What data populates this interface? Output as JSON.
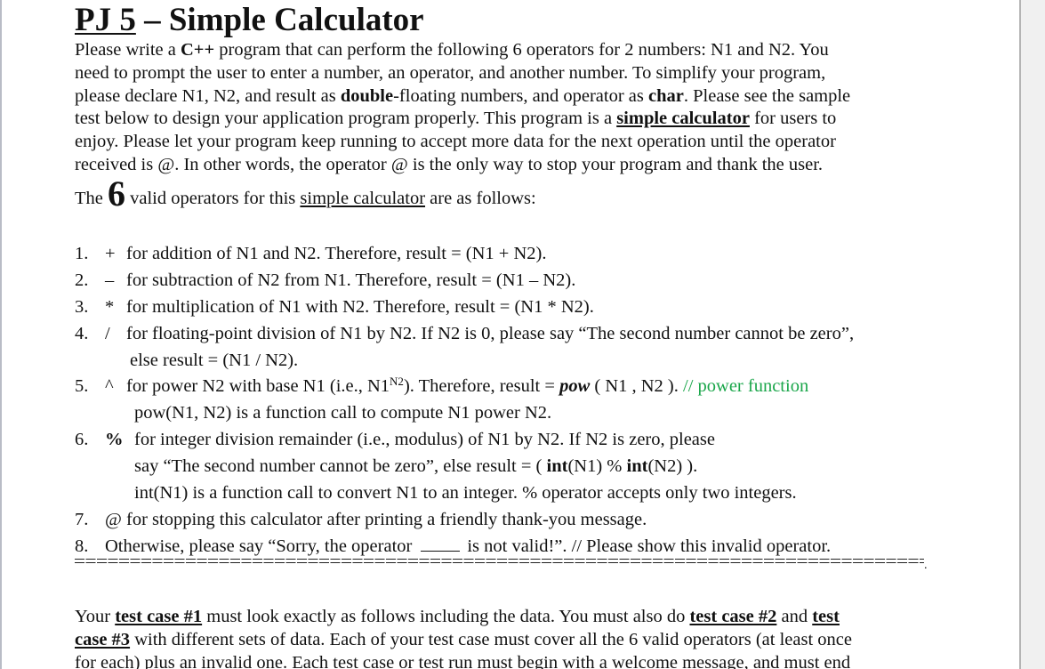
{
  "document": {
    "title_prefix": "PJ 5",
    "title_suffix": " – Simple Calculator",
    "intro_lines": [
      {
        "parts": [
          {
            "t": "Please write a "
          },
          {
            "t": "C++",
            "style": "b"
          },
          {
            "t": " program that can perform the following 6 operators for 2 numbers: N1 and N2.  You"
          }
        ]
      },
      {
        "parts": [
          {
            "t": "need to prompt the user to enter a number, an operator, and another number.  To simplify your program,"
          }
        ]
      },
      {
        "parts": [
          {
            "t": "please declare N1, N2, and result as "
          },
          {
            "t": "double",
            "style": "b"
          },
          {
            "t": "-floating numbers, and operator as "
          },
          {
            "t": "char",
            "style": "b"
          },
          {
            "t": ".  Please see the sample"
          }
        ]
      },
      {
        "parts": [
          {
            "t": "test below to design your application program properly.  This program is a "
          },
          {
            "t": "simple calculator",
            "style": "bu"
          },
          {
            "t": " for users to"
          }
        ]
      },
      {
        "parts": [
          {
            "t": "enjoy.   Please let your program keep running to accept more data for the next operation until the operator"
          }
        ]
      },
      {
        "parts": [
          {
            "t": "received is @.  In other words, the operator @ is the only way to stop your program and thank the user."
          }
        ]
      }
    ],
    "operators_heading": {
      "before": "The ",
      "count": "6",
      "middle": " valid operators for this ",
      "link": "simple calculator",
      "after": " are as follows:"
    },
    "operators": [
      {
        "num": "1.",
        "symbol": "+",
        "text": "for addition of  N1 and N2.  Therefore, result = (N1 + N2)."
      },
      {
        "num": "2.",
        "symbol": "–",
        "text": "for subtraction of  N2 from N1.  Therefore, result = (N1 – N2)."
      },
      {
        "num": "3.",
        "symbol": "*",
        "text": "for multiplication of  N1 with N2.  Therefore, result = (N1 * N2)."
      },
      {
        "num": "4.",
        "symbol": "/",
        "text": "for floating-point division of N1 by N2. If N2 is 0, please say “The second number cannot be zero”,",
        "continuation": [
          "else result = (N1 / N2)."
        ]
      },
      {
        "num": "5.",
        "symbol": "^",
        "text_before_sup": "for power N2 with base N1 (i.e., N1",
        "sup": "N2",
        "text_after_sup": ").  Therefore, result = ",
        "func": "pow",
        "func_args": " ( N1 , N2 ). ",
        "comment": "// power function",
        "continuation": [
          "pow(N1, N2) is a function call to compute N1 power N2."
        ]
      },
      {
        "num": "6.",
        "symbol": "%",
        "text": "for integer division remainder (i.e., modulus) of N1 by N2.  If N2 is zero, please",
        "cont2_before": "say  “The second number cannot be zero”, else result = ( ",
        "cont2_int1": "int",
        "cont2_mid": "(N1) % ",
        "cont2_int2": "int",
        "cont2_after": "(N2) ).",
        "cont3": "int(N1) is a function call to convert N1 to an integer.  % operator accepts only two integers."
      },
      {
        "num": "7.",
        "symbol": "@",
        "text": "for stopping this calculator after printing a friendly thank-you message."
      },
      {
        "num": "8.",
        "text_before_blank": "Otherwise, please say “Sorry, the operator",
        "text_after_blank": "is not valid!”.  // Please show this invalid operator."
      }
    ],
    "separator_end": ".",
    "testcase_lines": [
      {
        "parts": [
          {
            "t": "Your "
          },
          {
            "t": "test case #1",
            "style": "bu"
          },
          {
            "t": " must look exactly as follows including the data. You must also do "
          },
          {
            "t": "test case #2",
            "style": "bu"
          },
          {
            "t": " and "
          },
          {
            "t": "test",
            "style": "bu"
          }
        ]
      },
      {
        "parts": [
          {
            "t": "case #3",
            "style": "bu"
          },
          {
            "t": " with different sets of data.  Each of your test case must cover all the 6 valid operators (at least once"
          }
        ]
      },
      {
        "parts": [
          {
            "t": "for each) plus an invalid one.  Each test case or test run must begin with a welcome message, and must end"
          }
        ]
      }
    ]
  },
  "colors": {
    "comment_green": "#1aa64a",
    "text": "#111111",
    "page_background": "#ffffff",
    "app_background": "#f0f0f0"
  }
}
